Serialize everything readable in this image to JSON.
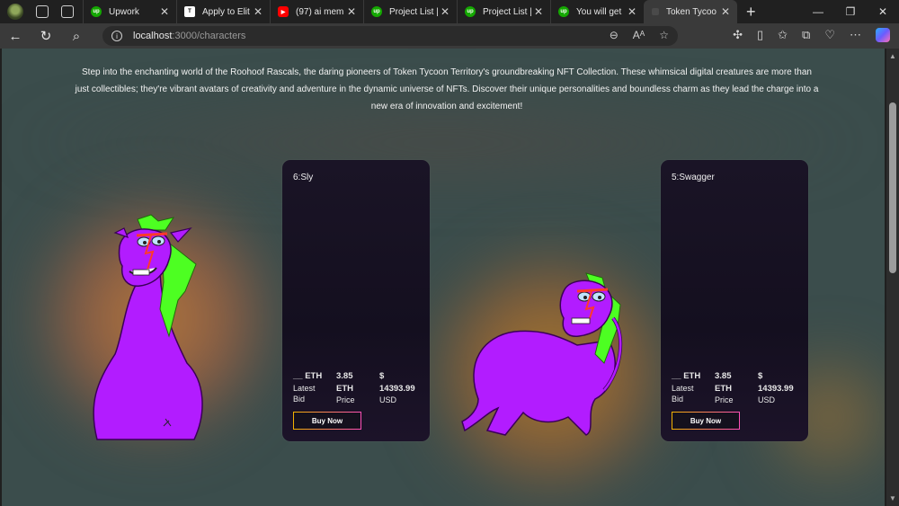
{
  "browser": {
    "tabs": [
      {
        "label": "Upwork",
        "favicon": "upwork-icon"
      },
      {
        "label": "Apply to Elit",
        "favicon": "toptal-icon"
      },
      {
        "label": "(97) ai mem",
        "favicon": "youtube-icon"
      },
      {
        "label": "Project List |",
        "favicon": "upwork-icon"
      },
      {
        "label": "Project List |",
        "favicon": "upwork-icon"
      },
      {
        "label": "You will get",
        "favicon": "upwork-icon"
      },
      {
        "label": "Token Tycoo",
        "favicon": "page-icon",
        "active": true
      }
    ],
    "url_host": "localhost",
    "url_path": ":3000/characters"
  },
  "intro": {
    "text": "Step into the enchanting world of the Roohoof Rascals, the daring pioneers of Token Tycoon Territory's groundbreaking NFT Collection. These whimsical digital creatures are more than just collectibles; they're vibrant avatars of creativity and adventure in the dynamic universe of NFTs. Discover their unique personalities and boundless charm as they lead the charge into a new era of innovation and excitement!"
  },
  "cards": [
    {
      "name": "6:Sly",
      "bid_value": "__ ETH",
      "bid_label_1": "Latest",
      "bid_label_2": "Bid",
      "price_value": "3.85",
      "price_unit": "ETH",
      "price_label": "Price",
      "usd_symbol": "$",
      "usd_value": "14393.99",
      "usd_label": "USD",
      "button": "Buy Now"
    },
    {
      "name": "5:Swagger",
      "bid_value": "__ ETH",
      "bid_label_1": "Latest",
      "bid_label_2": "Bid",
      "price_value": "3.85",
      "price_unit": "ETH",
      "price_label": "Price",
      "usd_symbol": "$",
      "usd_value": "14393.99",
      "usd_label": "USD",
      "button": "Buy Now"
    }
  ],
  "colors": {
    "creature": "#b21cff",
    "mane": "#4dff22",
    "button_gradient_start": "#f1b200",
    "button_gradient_end": "#ff4fb8"
  }
}
